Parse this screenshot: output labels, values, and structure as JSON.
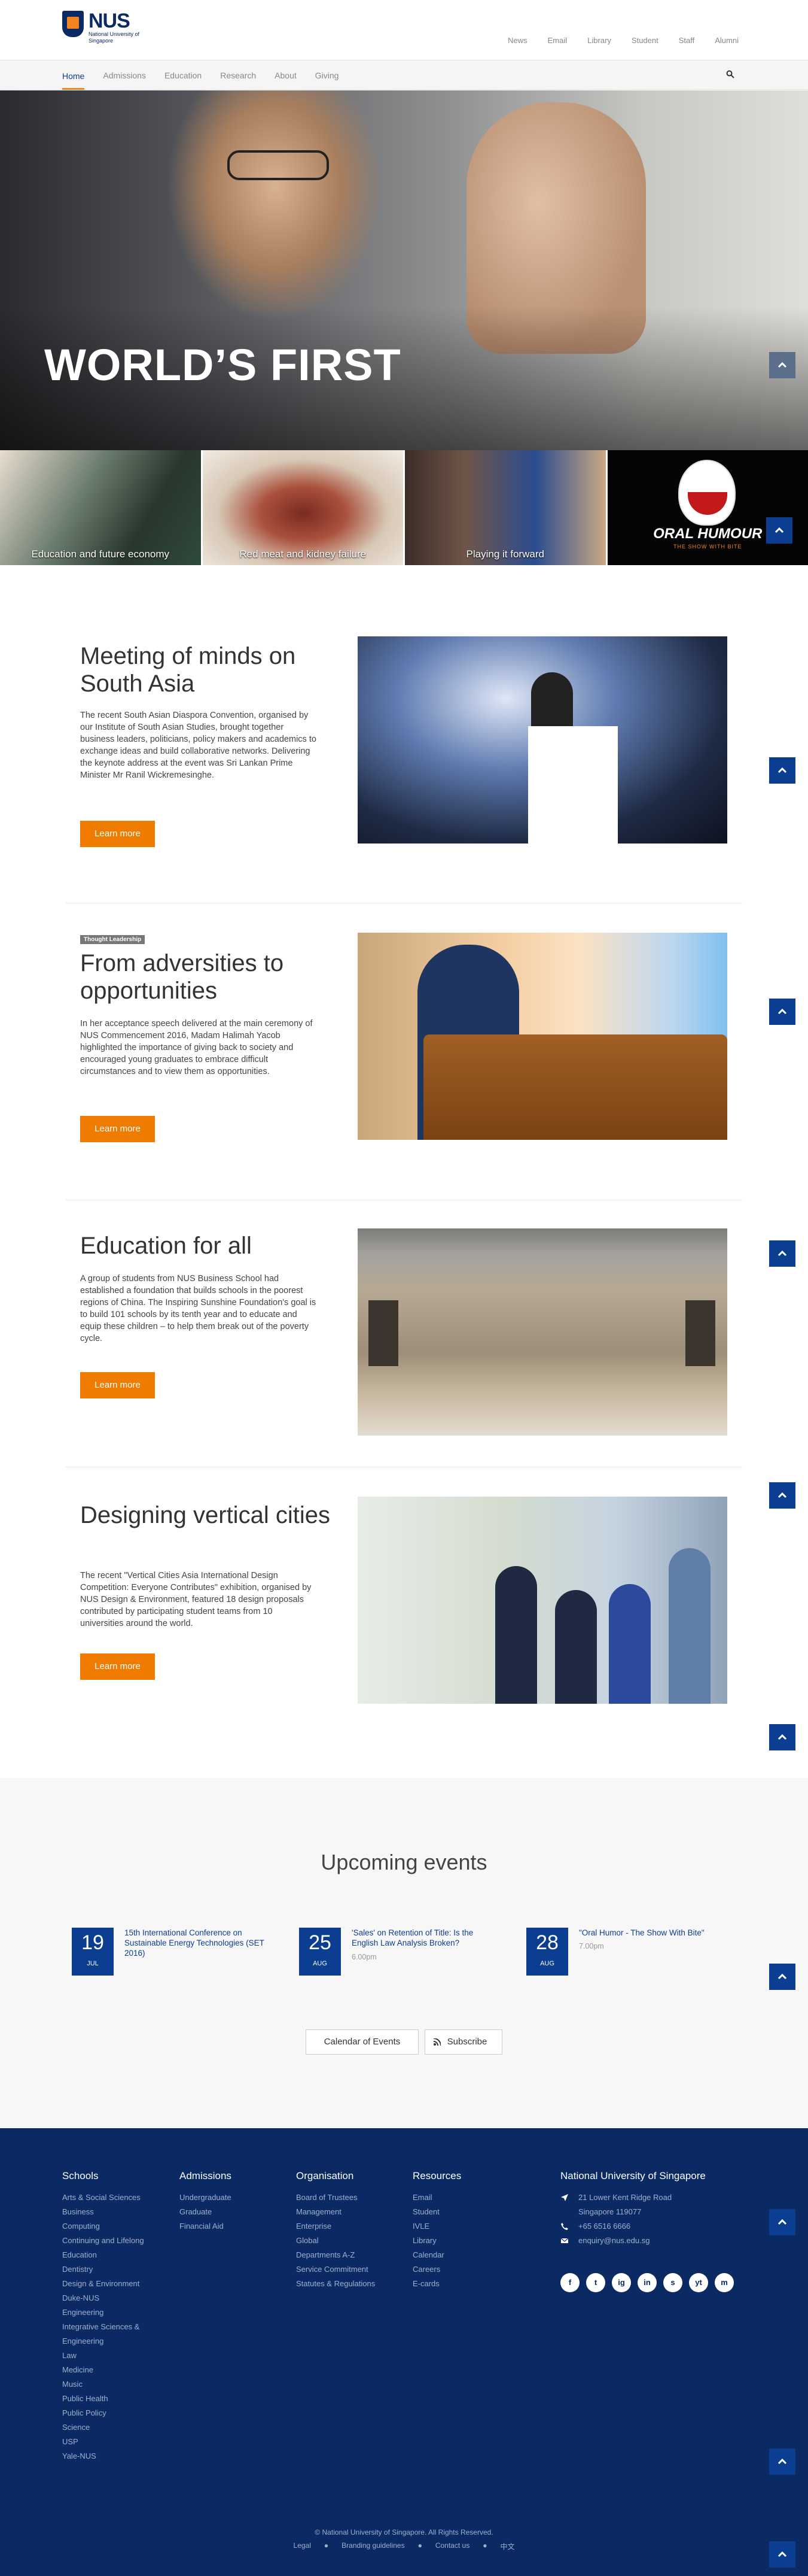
{
  "brand": {
    "name": "NUS",
    "sub": "National University of Singapore"
  },
  "utility_nav": [
    "News",
    "Email",
    "Library",
    "Student",
    "Staff",
    "Alumni"
  ],
  "main_nav": [
    "Home",
    "Admissions",
    "Education",
    "Research",
    "About",
    "Giving"
  ],
  "hero": {
    "title": "WORLD’S FIRST"
  },
  "tiles": [
    {
      "caption": "Education and future economy"
    },
    {
      "caption": "Red meat and kidney failure"
    },
    {
      "caption": "Playing it forward"
    },
    {
      "caption": "",
      "logo_text": "ORAL HUMOUR",
      "logo_sub": "THE SHOW WITH BITE"
    }
  ],
  "stories": [
    {
      "tag": "",
      "title": "Meeting of minds on South Asia",
      "body": "The recent South Asian Diaspora Convention, organised by our Institute of South Asian Studies, brought together business leaders, politicians, policy makers and academics to exchange ideas and build collaborative networks. Delivering the keynote address at the event was Sri Lankan Prime Minister Mr Ranil Wickremesinghe.",
      "button": "Learn more"
    },
    {
      "tag": "Thought Leadership",
      "title": "From adversities to opportunities",
      "body": "In her acceptance speech delivered at the main ceremony of NUS Commencement 2016, Madam Halimah Yacob highlighted the importance of giving back to society and encouraged young graduates to embrace difficult circumstances and to view them as opportunities.",
      "button": "Learn more"
    },
    {
      "tag": "",
      "title": "Education for all",
      "body": "A group of students from NUS Business School had established a foundation that builds schools in the poorest regions of China. The Inspiring Sunshine Foundation's goal is to build 101 schools by its tenth year and to educate and equip these children – to help them break out of the poverty cycle.",
      "button": "Learn more"
    },
    {
      "tag": "",
      "title": "Designing vertical cities",
      "body": "The recent \"Vertical Cities Asia International Design Competition: Everyone Contributes\" exhibition, organised by NUS Design & Environment, featured 18 design proposals contributed by participating student teams from 10 universities around the world.",
      "button": "Learn more"
    }
  ],
  "events": {
    "heading": "Upcoming events",
    "items": [
      {
        "day": "19",
        "month": "JUL",
        "title": "15th International Conference on Sustainable Energy Technologies (SET 2016)",
        "time": ""
      },
      {
        "day": "25",
        "month": "AUG",
        "title": "'Sales' on Retention of Title: Is the English Law Analysis Broken?",
        "time": "6.00pm"
      },
      {
        "day": "28",
        "month": "AUG",
        "title": "\"Oral Humor - The Show With Bite\"",
        "time": "7.00pm"
      }
    ],
    "calendar_button": "Calendar of Events",
    "subscribe_button": "Subscribe"
  },
  "footer": {
    "schools": {
      "heading": "Schools",
      "items": [
        "Arts & Social Sciences",
        "Business",
        "Computing",
        "Continuing and Lifelong Education",
        "Dentistry",
        "Design & Environment",
        "Duke-NUS",
        "Engineering",
        "Integrative Sciences & Engineering",
        "Law",
        "Medicine",
        "Music",
        "Public Health",
        "Public Policy",
        "Science",
        "USP",
        "Yale-NUS"
      ]
    },
    "admissions": {
      "heading": "Admissions",
      "items": [
        "Undergraduate",
        "Graduate",
        "Financial Aid"
      ]
    },
    "organisation": {
      "heading": "Organisation",
      "items": [
        "Board of Trustees",
        "Management",
        "Enterprise",
        "Global",
        "Departments A-Z",
        "Service Commitment",
        "Statutes & Regulations"
      ]
    },
    "resources": {
      "heading": "Resources",
      "items": [
        "Email",
        "Student",
        "IVLE",
        "Library",
        "Calendar",
        "Careers",
        "E-cards"
      ]
    },
    "contact": {
      "heading": "National University of Singapore",
      "address1": "21 Lower Kent Ridge Road",
      "address2": "Singapore 119077",
      "phone": "+65 6516 6666",
      "email": "enquiry@nus.edu.sg"
    },
    "social": [
      "f",
      "t",
      "ig",
      "in",
      "s",
      "yt",
      "m"
    ],
    "copyright": "© National University of Singapore. All Rights Reserved.",
    "legal_links": [
      "Legal",
      "Branding guidelines",
      "Contact us",
      "中文"
    ]
  },
  "colors": {
    "navy": "#0b2a63",
    "blue": "#0b3d91",
    "orange": "#ef7c00"
  }
}
